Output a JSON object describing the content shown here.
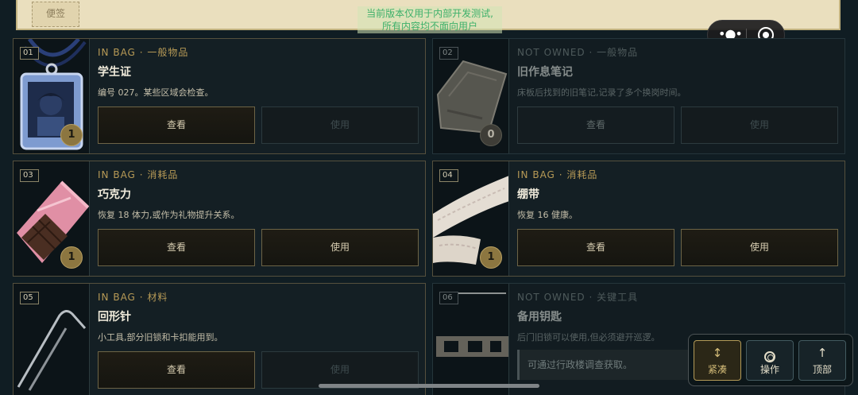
{
  "note": {
    "tag": "便签"
  },
  "notice": {
    "line1": "当前版本仅用于内部开发测试,",
    "line2": "所有内容均不面向用户"
  },
  "capsule": {
    "menu_icon": "more-dots-icon",
    "close_icon": "target-close-icon"
  },
  "items": [
    {
      "index": "01",
      "status": "IN BAG",
      "category": "一般物品",
      "name": "学生证",
      "desc": "编号 027。某些区域会检查。",
      "qty": "1",
      "view_label": "查看",
      "use_label": "使用",
      "use_enabled": false,
      "owned": true,
      "icon": "student-id-card-icon"
    },
    {
      "index": "02",
      "status": "NOT OWNED",
      "category": "一般物品",
      "name": "旧作息笔记",
      "desc": "床板后找到的旧笔记,记录了多个换岗时间。",
      "qty": "0",
      "view_label": "查看",
      "use_label": "使用",
      "use_enabled": false,
      "owned": false,
      "icon": "old-notebook-icon"
    },
    {
      "index": "03",
      "status": "IN BAG",
      "category": "消耗品",
      "name": "巧克力",
      "desc": "恢复 18 体力,或作为礼物提升关系。",
      "qty": "1",
      "view_label": "查看",
      "use_label": "使用",
      "use_enabled": true,
      "owned": true,
      "icon": "chocolate-bar-icon"
    },
    {
      "index": "04",
      "status": "IN BAG",
      "category": "消耗品",
      "name": "绷带",
      "desc": "恢复 16 健康。",
      "qty": "1",
      "view_label": "查看",
      "use_label": "使用",
      "use_enabled": true,
      "owned": true,
      "icon": "bandage-roll-icon"
    },
    {
      "index": "05",
      "status": "IN BAG",
      "category": "材料",
      "name": "回形针",
      "desc": "小工具,部分旧锁和卡扣能用到。",
      "qty": "1",
      "view_label": "查看",
      "use_label": "使用",
      "use_enabled": false,
      "owned": true,
      "icon": "paperclip-icon"
    },
    {
      "index": "06",
      "status": "NOT OWNED",
      "category": "关键工具",
      "name": "备用钥匙",
      "desc": "后门旧锁可以使用,但必须避开巡逻。",
      "hint": "可通过行政楼调查获取。",
      "owned": false,
      "icon": "spare-key-icon"
    }
  ],
  "meta_separator": "·",
  "toolbar": [
    {
      "label": "紧凑",
      "icon": "compact-arrows-icon",
      "active": true
    },
    {
      "label": "操作",
      "icon": "action-ring-icon",
      "active": false
    },
    {
      "label": "顶部",
      "icon": "arrow-up-icon",
      "active": false
    }
  ]
}
